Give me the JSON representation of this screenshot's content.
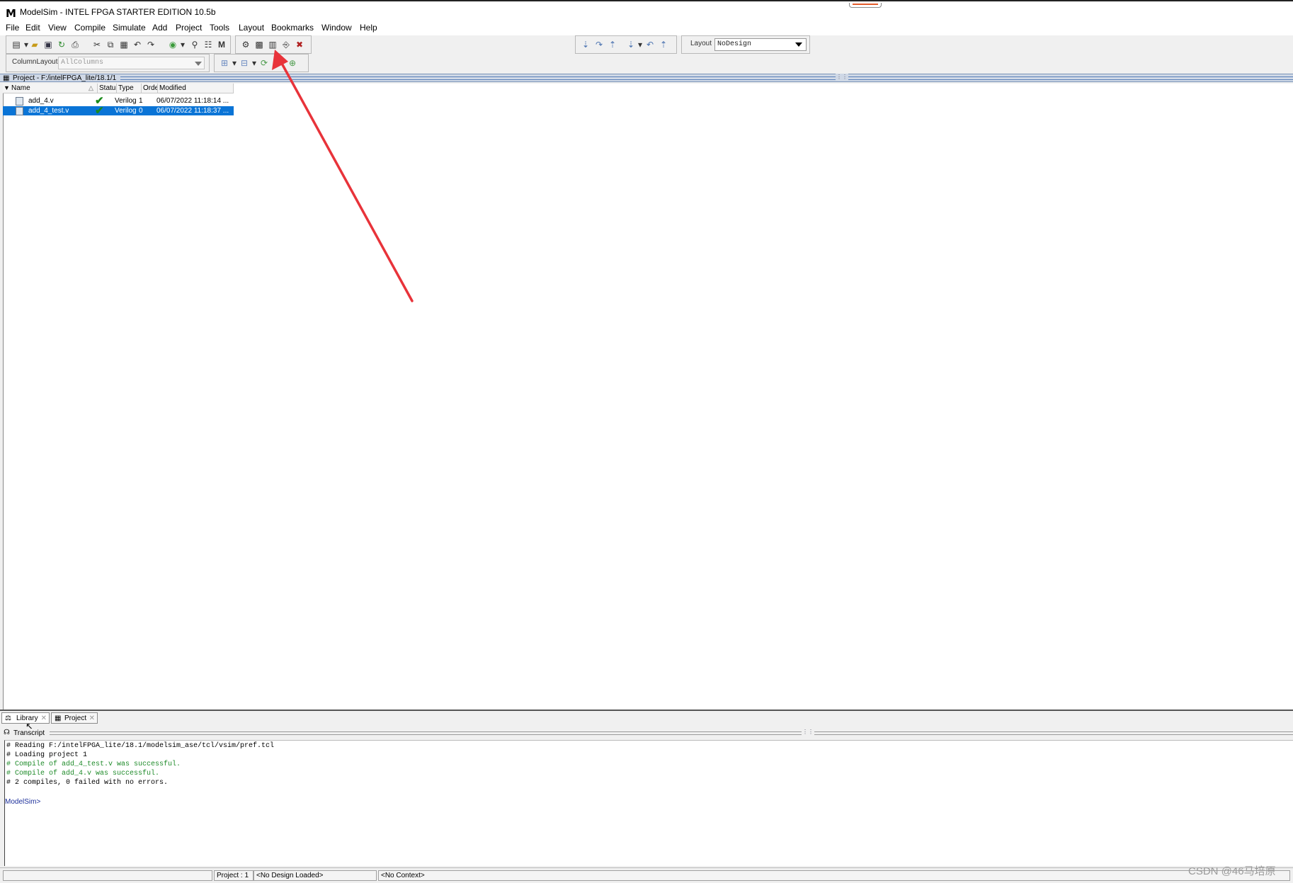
{
  "window": {
    "title": "ModelSim - INTEL FPGA STARTER EDITION 10.5b",
    "logo": "M"
  },
  "menu": [
    "File",
    "Edit",
    "View",
    "Compile",
    "Simulate",
    "Add",
    "Project",
    "Tools",
    "Layout",
    "Bookmarks",
    "Window",
    "Help"
  ],
  "toolbar": {
    "layout_label": "Layout",
    "layout_value": "NoDesign",
    "column_layout_label": "ColumnLayout",
    "column_layout_value": "AllColumns"
  },
  "project_pane": {
    "title": "Project - F:/intelFPGA_lite/18.1/1",
    "columns": [
      "Name",
      "Status",
      "Type",
      "Order",
      "Modified"
    ],
    "rows": [
      {
        "name": "add_4.v",
        "status": "✔",
        "type": "Verilog",
        "order": "1",
        "modified": "06/07/2022 11:18:14 ...",
        "selected": false
      },
      {
        "name": "add_4_test.v",
        "status": "✔",
        "type": "Verilog",
        "order": "0",
        "modified": "06/07/2022 11:18:37 ...",
        "selected": true
      }
    ]
  },
  "tabs": [
    {
      "label": "Library",
      "active": true
    },
    {
      "label": "Project",
      "active": false
    }
  ],
  "transcript": {
    "title": "Transcript",
    "lines": [
      {
        "text": "# Reading F:/intelFPGA_lite/18.1/modelsim_ase/tcl/vsim/pref.tcl",
        "color": "black"
      },
      {
        "text": "# Loading project 1",
        "color": "black"
      },
      {
        "text": "# Compile of add_4_test.v was successful.",
        "color": "green"
      },
      {
        "text": "# Compile of add_4.v was successful.",
        "color": "green"
      },
      {
        "text": "# 2 compiles, 0 failed with no errors.",
        "color": "black"
      }
    ],
    "prompt": "ModelSim>"
  },
  "statusbar": {
    "project": "Project : 1",
    "design": "<No Design Loaded>",
    "context": "<No Context>"
  },
  "watermark": "CSDN @46马培原",
  "colors": {
    "selection": "#0a74d6",
    "arrow": "#e8333a",
    "success": "#1f8b2a"
  }
}
